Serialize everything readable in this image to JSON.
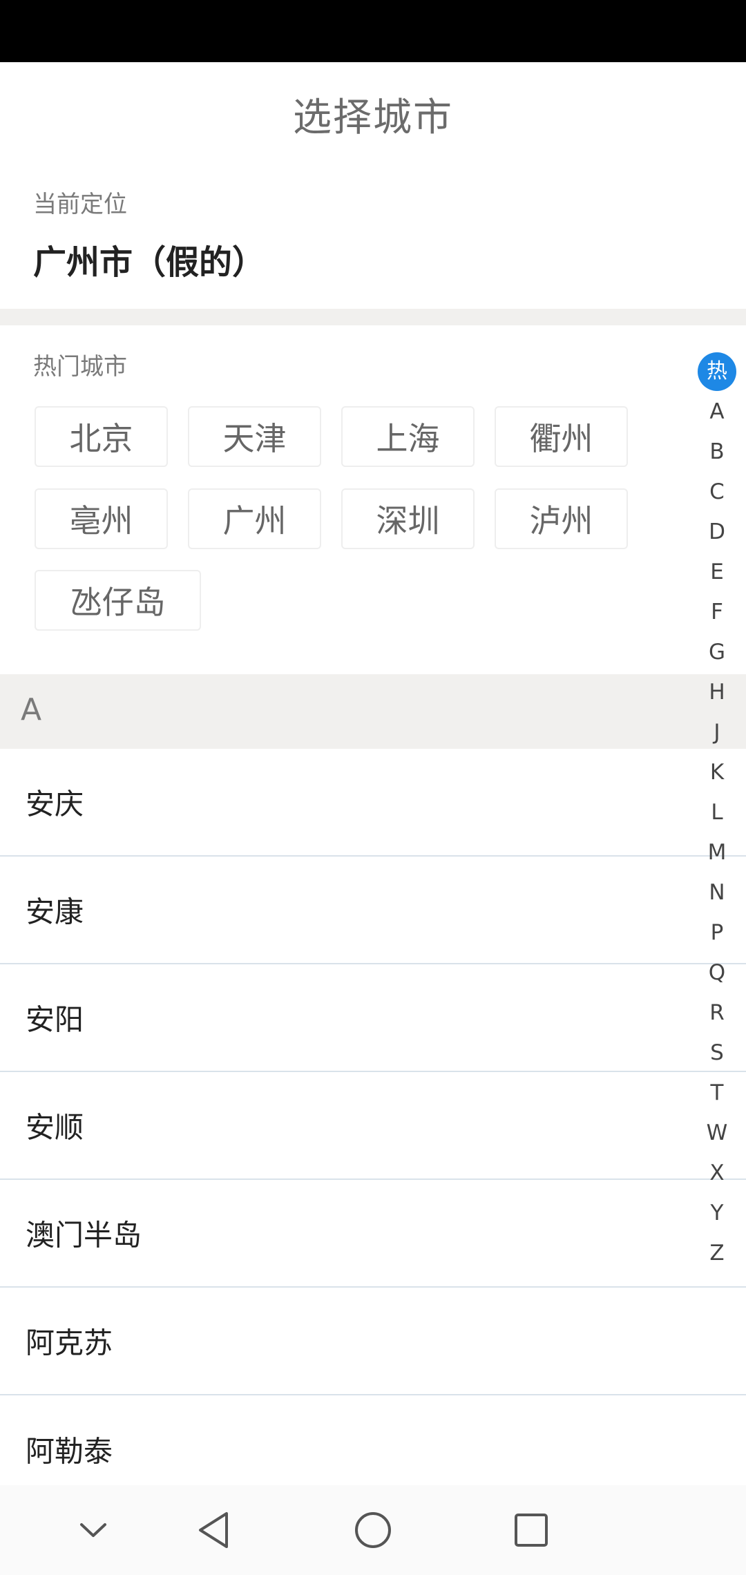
{
  "header": {
    "title": "选择城市"
  },
  "current_location": {
    "label": "当前定位",
    "value": "广州市（假的）"
  },
  "hot_cities": {
    "label": "热门城市",
    "items": [
      "北京",
      "天津",
      "上海",
      "衢州",
      "亳州",
      "广州",
      "深圳",
      "泸州",
      "氹仔岛"
    ]
  },
  "section": {
    "letter": "A"
  },
  "cities": [
    "安庆",
    "安康",
    "安阳",
    "安顺",
    "澳门半岛",
    "阿克苏",
    "阿勒泰"
  ],
  "index_bar": {
    "items": [
      "热",
      "A",
      "B",
      "C",
      "D",
      "E",
      "F",
      "G",
      "H",
      "J",
      "K",
      "L",
      "M",
      "N",
      "P",
      "Q",
      "R",
      "S",
      "T",
      "W",
      "X",
      "Y",
      "Z"
    ],
    "active": "热",
    "accent_color": "#1e88e5"
  },
  "nav_bar": {
    "icons": [
      "chevron-down-icon",
      "back-icon",
      "home-icon",
      "recents-icon"
    ]
  }
}
